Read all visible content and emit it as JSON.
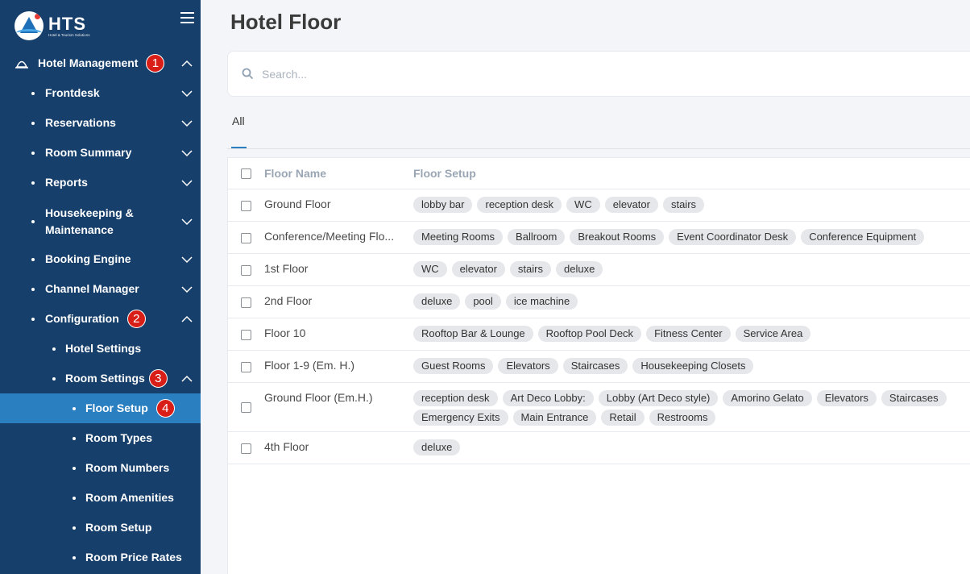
{
  "brand": {
    "name": "HTS",
    "tagline": "Hotel & Tourism Solutions"
  },
  "sidebar": {
    "items": [
      {
        "label": "Hotel Management",
        "badge": "1"
      },
      {
        "label": "Frontdesk"
      },
      {
        "label": "Reservations"
      },
      {
        "label": "Room Summary"
      },
      {
        "label": "Reports"
      },
      {
        "label": "Housekeeping &",
        "label2": "Maintenance"
      },
      {
        "label": "Booking Engine"
      },
      {
        "label": "Channel Manager"
      },
      {
        "label": "Configuration",
        "badge": "2"
      },
      {
        "label": "Hotel Settings"
      },
      {
        "label": "Room Settings",
        "badge": "3"
      },
      {
        "label": "Floor Setup",
        "badge": "4"
      },
      {
        "label": "Room Types"
      },
      {
        "label": "Room Numbers"
      },
      {
        "label": "Room Amenities"
      },
      {
        "label": "Room Setup"
      },
      {
        "label": "Room Price Rates"
      }
    ]
  },
  "main": {
    "title": "Hotel Floor",
    "search": {
      "placeholder": "Search..."
    },
    "tabs": [
      {
        "label": "All"
      }
    ],
    "table": {
      "headers": {
        "name": "Floor Name",
        "setup": "Floor Setup"
      },
      "rows": [
        {
          "name": "Ground Floor",
          "tags": [
            "lobby bar",
            "reception desk",
            "WC",
            "elevator",
            "stairs"
          ]
        },
        {
          "name": "Conference/Meeting Flo...",
          "tags": [
            "Meeting Rooms",
            "Ballroom",
            "Breakout Rooms",
            "Event Coordinator Desk",
            "Conference Equipment"
          ]
        },
        {
          "name": "1st Floor",
          "tags": [
            "WC",
            "elevator",
            "stairs",
            "deluxe"
          ]
        },
        {
          "name": "2nd Floor",
          "tags": [
            "deluxe",
            "pool",
            "ice machine"
          ]
        },
        {
          "name": "Floor 10",
          "tags": [
            "Rooftop Bar & Lounge",
            "Rooftop Pool Deck",
            "Fitness Center",
            "Service Area"
          ]
        },
        {
          "name": "Floor 1-9 (Em. H.)",
          "tags": [
            "Guest Rooms",
            "Elevators",
            "Staircases",
            "Housekeeping Closets"
          ]
        },
        {
          "name": "Ground Floor (Em.H.)",
          "tags": [
            "reception desk",
            "Art Deco Lobby:",
            "Lobby (Art Deco style)",
            "Amorino Gelato",
            "Elevators",
            "Staircases",
            "Emergency Exits",
            "Main Entrance",
            "Retail",
            "Restrooms"
          ]
        },
        {
          "name": "4th Floor",
          "tags": [
            "deluxe"
          ]
        }
      ]
    }
  }
}
